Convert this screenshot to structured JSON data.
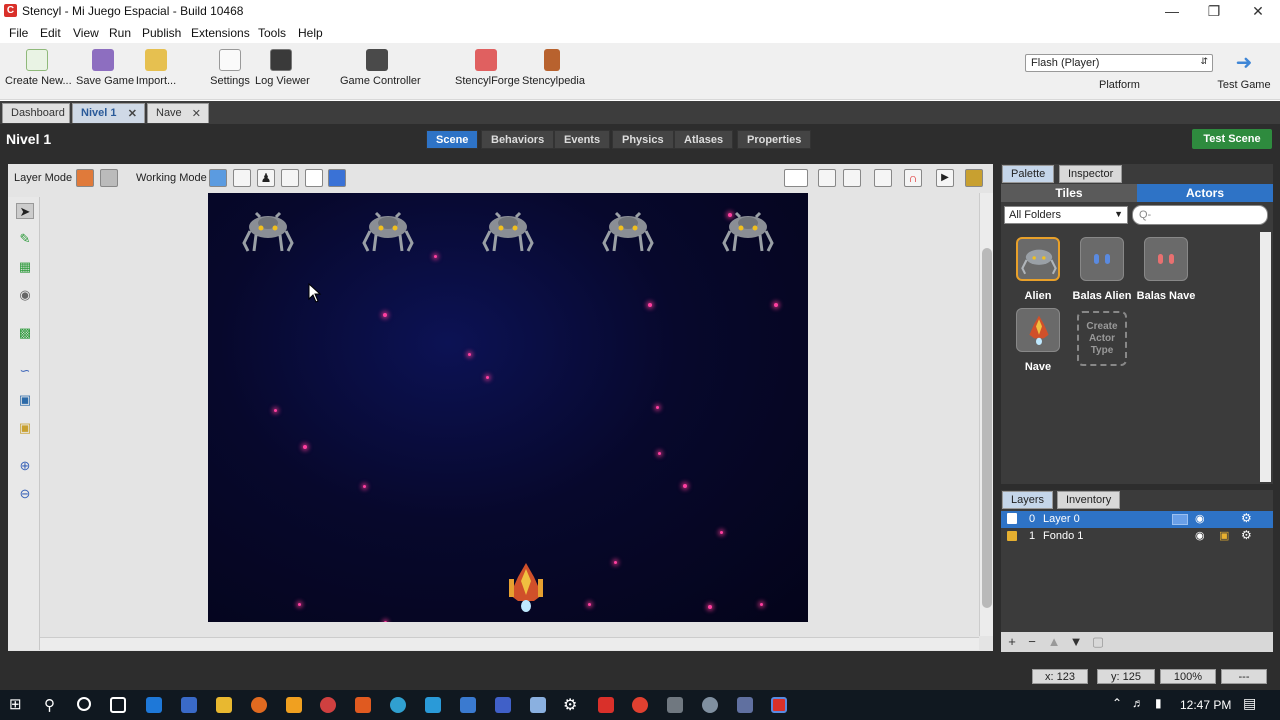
{
  "window": {
    "title": "Stencyl - Mi Juego Espacial - Build 10468",
    "app_icon": "C"
  },
  "menu": [
    "File",
    "Edit",
    "View",
    "Run",
    "Publish",
    "Extensions",
    "Tools",
    "Help"
  ],
  "toolbar": {
    "create": "Create New...",
    "save": "Save Game",
    "import": "Import...",
    "settings": "Settings",
    "log": "Log Viewer",
    "controller": "Game Controller",
    "forge": "StencylForge",
    "pedia": "Stencylpedia",
    "platform_value": "Flash (Player)",
    "platform_label": "Platform",
    "test_game": "Test Game"
  },
  "doc_tabs": [
    {
      "label": "Dashboard"
    },
    {
      "label": "Nivel 1"
    },
    {
      "label": "Nave"
    }
  ],
  "scene": {
    "title": "Nivel 1",
    "tabs": [
      "Scene",
      "Behaviors",
      "Events",
      "Physics",
      "Atlases",
      "Properties"
    ],
    "test_scene": "Test Scene",
    "layer_mode": "Layer Mode",
    "working_mode": "Working Mode"
  },
  "palette": {
    "tabs": [
      "Palette",
      "Inspector"
    ],
    "tiles": "Tiles",
    "actors_tab": "Actors",
    "folder": "All Folders",
    "search_placeholder": "Q-",
    "actors": [
      "Alien",
      "Balas Alien",
      "Balas Nave",
      "Nave"
    ],
    "create_actor": "Create Actor Type"
  },
  "layers": {
    "tabs": [
      "Layers",
      "Inventory"
    ],
    "rows": [
      {
        "index": "0",
        "name": "Layer 0"
      },
      {
        "index": "1",
        "name": "Fondo 1"
      }
    ]
  },
  "status": {
    "x": "x:  123",
    "y": "y:  125",
    "zoom": "100%",
    "extra": "---"
  },
  "tray": {
    "time": "12:47 PM"
  },
  "colors": {
    "accent": "#2e73c6",
    "test_scene": "#2e8b3e",
    "selected_actor": "#e8a02a"
  }
}
